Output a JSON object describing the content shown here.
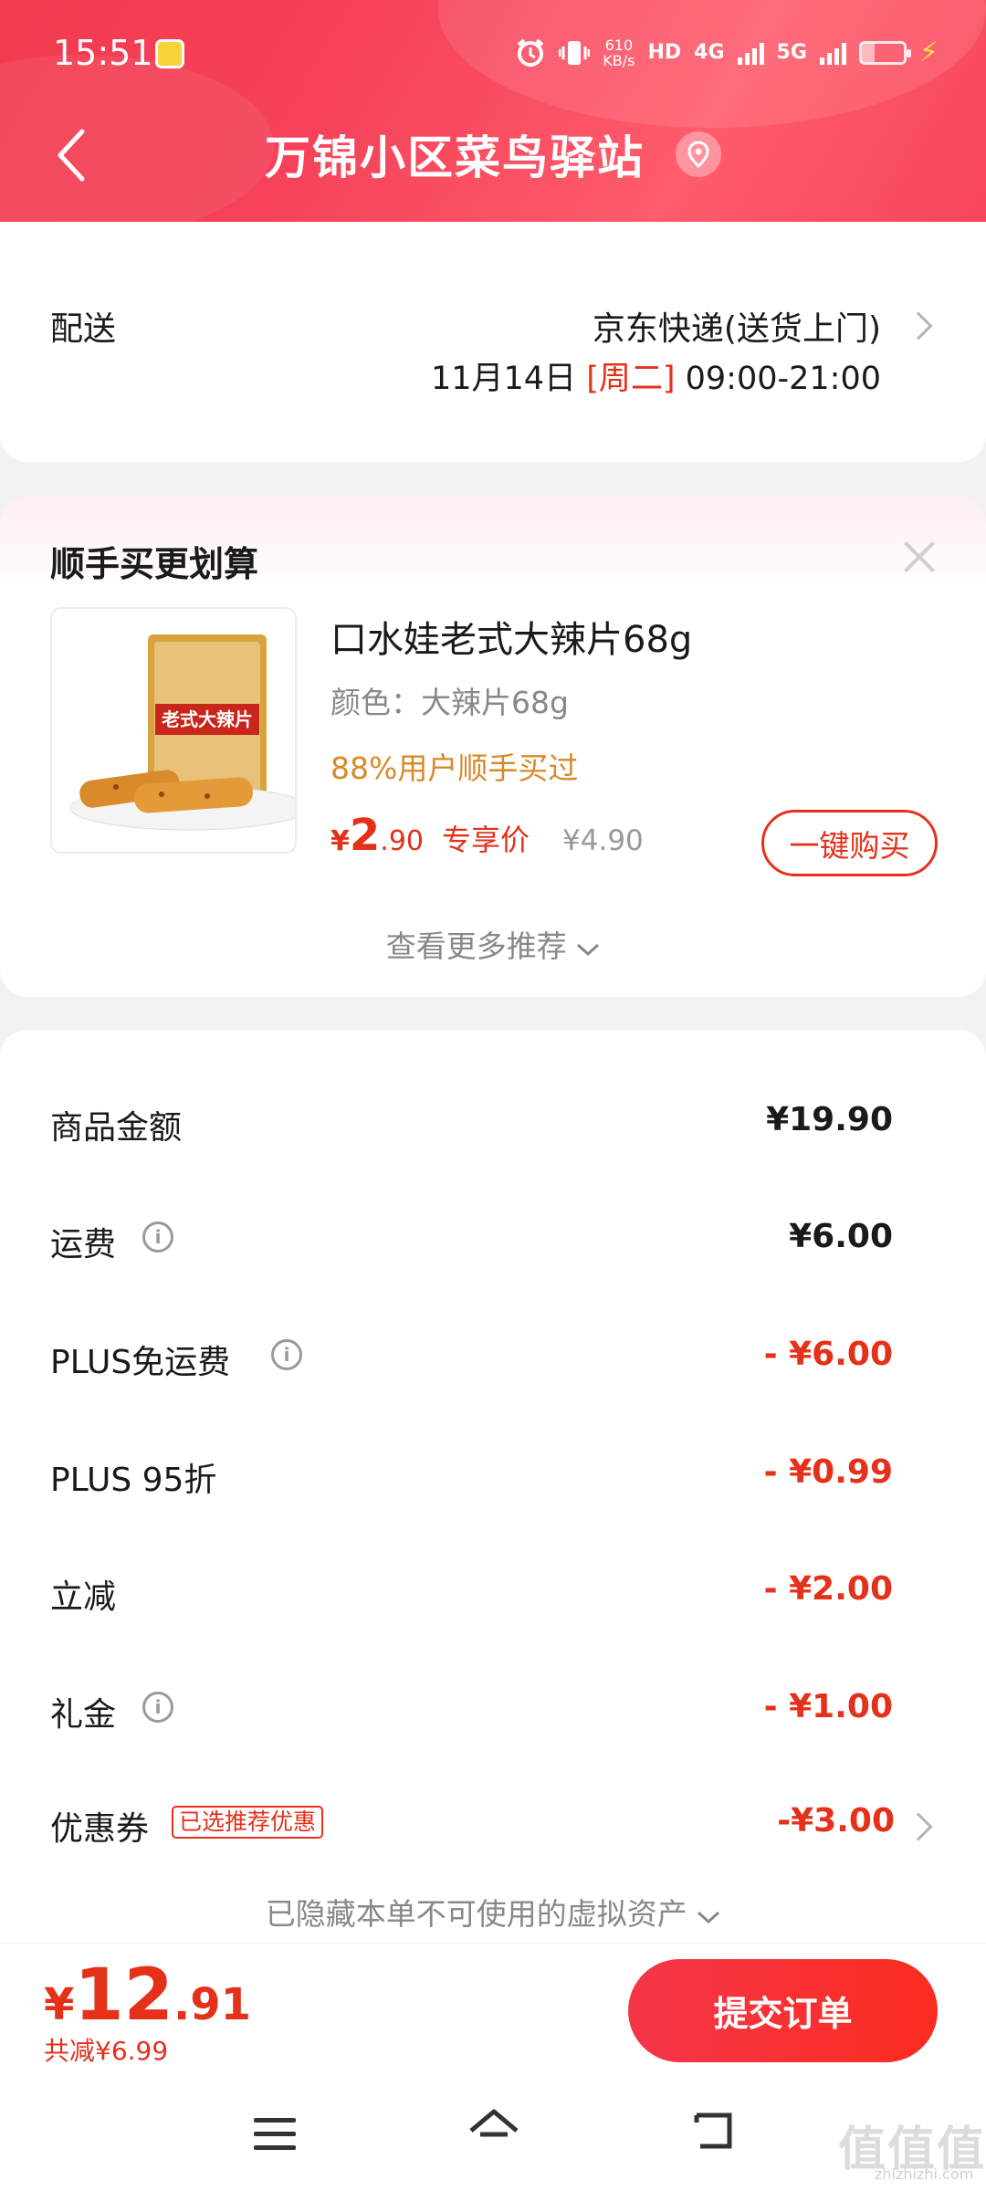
{
  "status_bar": {
    "time": "15:51",
    "net_speed_value": "610",
    "net_speed_unit": "KB/s",
    "hd_label": "HD",
    "network_4g": "4G",
    "network_5g": "5G"
  },
  "header": {
    "title": "万锦小区菜鸟驿站"
  },
  "delivery": {
    "label": "配送",
    "method": "京东快递(送货上门)",
    "date": "11月14日",
    "weekday": "[周二]",
    "time_window": "09:00-21:00"
  },
  "upsell": {
    "title": "顺手买更划算",
    "product": {
      "name": "口水娃老式大辣片68g",
      "image_text": "老式大辣片",
      "spec": "颜色：大辣片68g",
      "social_proof": "88%用户顺手买过",
      "price_symbol": "¥",
      "price_int": "2",
      "price_dec": ".90",
      "price_tag": "专享价",
      "original_price": "¥4.90",
      "buy_label": "一键购买"
    },
    "more_label": "查看更多推荐"
  },
  "summary": {
    "rows": [
      {
        "label": "商品金额",
        "value": "¥19.90"
      },
      {
        "label": "运费",
        "value": "¥6.00"
      },
      {
        "label": "PLUS免运费",
        "value": "- ¥6.00"
      },
      {
        "label": "PLUS 95折",
        "value": "- ¥0.99"
      },
      {
        "label": "立减",
        "value": "- ¥2.00"
      },
      {
        "label": "礼金",
        "value": "- ¥1.00"
      },
      {
        "label": "优惠券",
        "value": "-¥3.00"
      }
    ],
    "coupon_badge": "已选推荐优惠",
    "hidden_assets": "已隐藏本单不可使用的虚拟资产"
  },
  "footer": {
    "currency": "¥",
    "total_int": "12",
    "total_dec": ".91",
    "saved": "共减¥6.99",
    "submit_label": "提交订单"
  },
  "watermark": {
    "text": "值值值",
    "url": "zhizhizhi.com"
  },
  "colors": {
    "brand_red": "#e5301a",
    "header_red": "#f23a4e"
  }
}
